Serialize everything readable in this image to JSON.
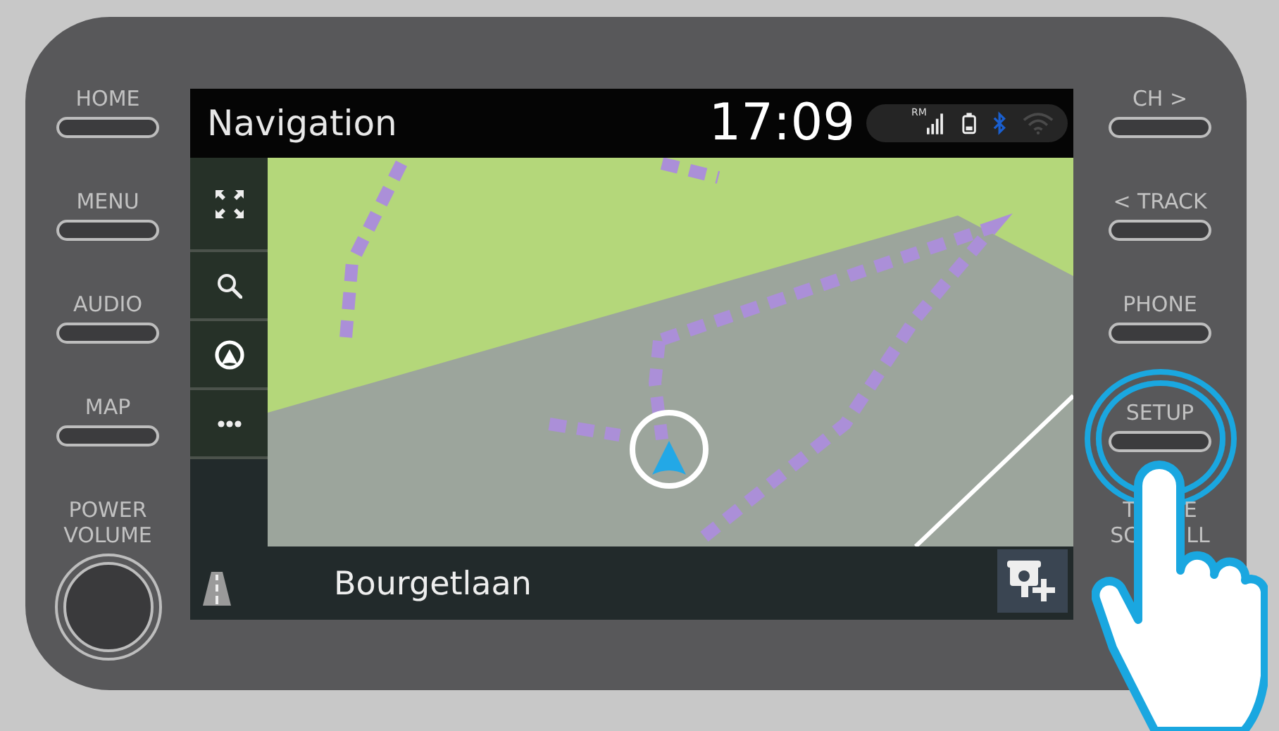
{
  "left_buttons": [
    {
      "label": "HOME",
      "highlighted": false
    },
    {
      "label": "MENU",
      "highlighted": false
    },
    {
      "label": "AUDIO",
      "highlighted": false
    },
    {
      "label": "MAP",
      "highlighted": false
    }
  ],
  "power_volume": {
    "label_lines": [
      "POWER",
      "VOLUME"
    ]
  },
  "right_buttons": [
    {
      "label": "CH >",
      "highlighted": false
    },
    {
      "label": "< TRACK",
      "highlighted": false
    },
    {
      "label": "PHONE",
      "highlighted": false
    },
    {
      "label": "SETUP",
      "highlighted": true
    }
  ],
  "tune_scroll": {
    "visible_parts": [
      [
        "T",
        "E"
      ],
      [
        "SC",
        "LL"
      ]
    ]
  },
  "screen": {
    "title": "Navigation",
    "time": "17:09",
    "status": {
      "signal_label": "RM",
      "bluetooth_on": true,
      "wifi_on": false
    },
    "side_buttons": [
      {
        "kind": "expand"
      },
      {
        "kind": "search"
      },
      {
        "kind": "compass"
      },
      {
        "kind": "more"
      }
    ],
    "street": "Bourgetlaan"
  }
}
